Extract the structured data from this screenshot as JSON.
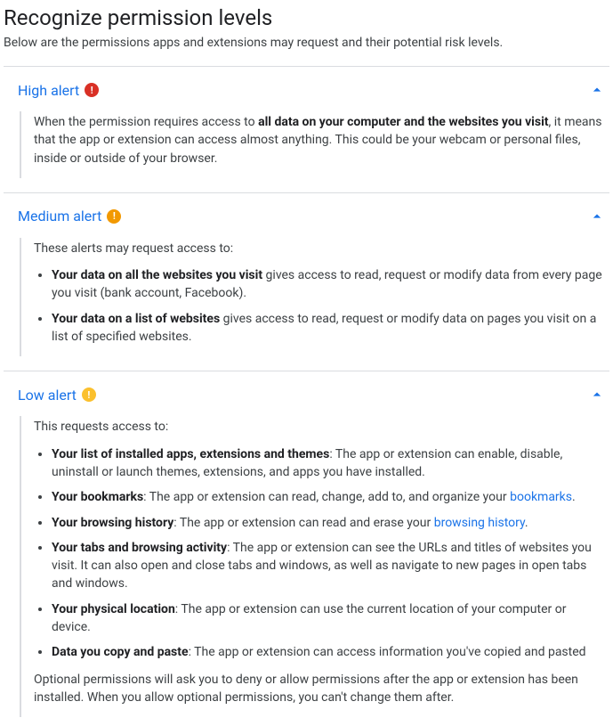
{
  "page": {
    "title": "Recognize permission levels",
    "intro": "Below are the permissions apps and extensions may request and their potential risk levels."
  },
  "sections": {
    "high": {
      "title": "High alert",
      "body_pre": "When the permission requires access to ",
      "body_bold": "all data on your computer and the websites you visit",
      "body_post": ", it means that the app or extension can access almost anything. This could be your webcam or personal files, inside or outside of your browser."
    },
    "medium": {
      "title": "Medium alert",
      "lead": "These alerts may request access to:",
      "items": {
        "0": {
          "bold": "Your data on all the websites you visit",
          "rest": " gives access to read, request or modify data from every page you visit (bank account, Facebook)."
        },
        "1": {
          "bold": "Your data on a list of websites",
          "rest": " gives access to read, request or modify data on pages you visit on a list of specified websites."
        }
      }
    },
    "low": {
      "title": "Low alert",
      "lead": "This requests access to:",
      "items": {
        "0": {
          "bold": "Your list of installed apps, extensions and themes",
          "rest": ": The app or extension can enable, disable, uninstall or launch themes, extensions, and apps you have installed."
        },
        "1": {
          "bold": "Your bookmarks",
          "rest": ": The app or extension can read, change, add to, and organize your ",
          "link": "bookmarks",
          "tail": "."
        },
        "2": {
          "bold": "Your browsing history",
          "rest": ": The app or extension can read and erase your ",
          "link": "browsing history",
          "tail": "."
        },
        "3": {
          "bold": "Your tabs and browsing activity",
          "rest": ": The app or extension can see the URLs and titles of websites you visit. It can also open and close tabs and windows, as well as navigate to new pages in open tabs and windows."
        },
        "4": {
          "bold": "Your physical location",
          "rest": ": The app or extension can use the current location of your computer or device."
        },
        "5": {
          "bold": "Data you copy and paste",
          "rest": ": The app or extension can access information you've copied and pasted"
        }
      },
      "footer": "Optional permissions will ask you to deny or allow permissions after the app or extension has been installed. When you allow optional permissions, you can't change them after."
    }
  }
}
